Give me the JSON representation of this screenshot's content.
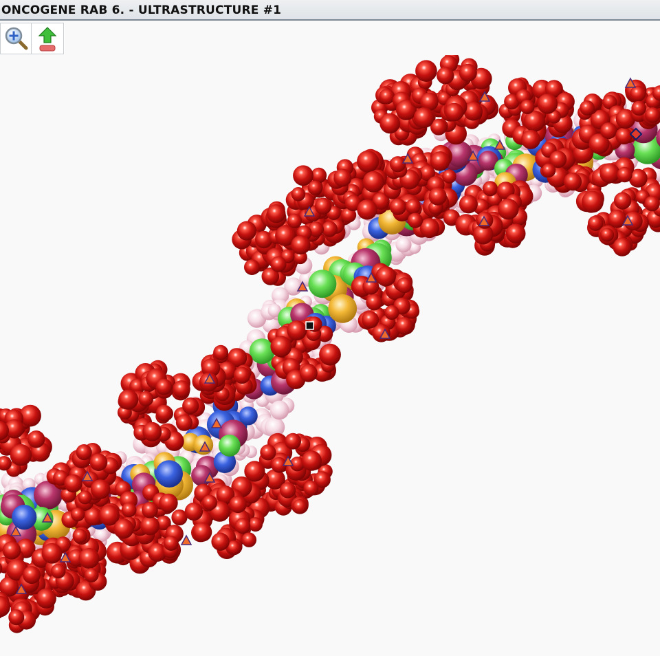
{
  "window": {
    "title": "ONCOGENE RAB 6. - ULTRASTRUCTURE #1"
  },
  "toolbar": {
    "buttons": [
      {
        "name": "zoom-in-button",
        "icon": "magnifier-plus-icon"
      },
      {
        "name": "export-button",
        "icon": "green-up-arrow-icon"
      }
    ]
  },
  "viewer": {
    "background": "#f9f9f9",
    "atom_colors": {
      "backbone_red": "#b30e0e",
      "sugar_pink": "#f3d3dd",
      "base_blue": "#2a52d6",
      "base_green": "#5fdc4a",
      "base_gold": "#f2b531",
      "base_magenta": "#b8336a"
    },
    "markers": {
      "triangle_count": 21,
      "square_count": 1,
      "diamond_count": 1
    }
  }
}
